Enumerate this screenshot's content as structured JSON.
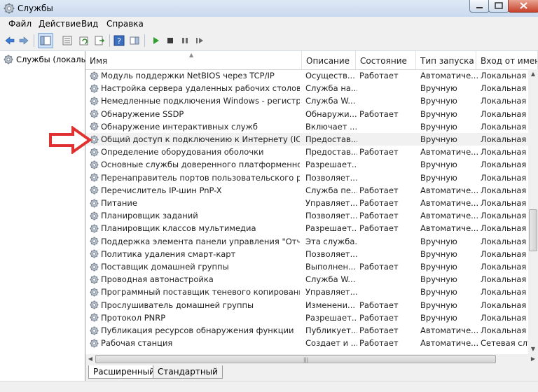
{
  "window": {
    "title": "Службы"
  },
  "menu": {
    "file": "Файл",
    "action": "Действие",
    "view": "Вид",
    "help": "Справка"
  },
  "left_pane": {
    "tree_item": "Службы (локалы"
  },
  "columns": {
    "name": "Имя",
    "description": "Описание",
    "status": "Состояние",
    "startup": "Тип запуска",
    "logon": "Вход от имен"
  },
  "rows": [
    {
      "name": "Модуль поддержки NetBIOS через TCP/IP",
      "desc": "Осуществ...",
      "status": "Работает",
      "startup": "Автоматиче...",
      "logon": "Локальная с"
    },
    {
      "name": "Настройка сервера удаленных рабочих столов",
      "desc": "Служба на...",
      "status": "",
      "startup": "Вручную",
      "logon": "Локальная с"
    },
    {
      "name": "Немедленные подключения Windows - регистратор...",
      "desc": "Служба W...",
      "status": "",
      "startup": "Вручную",
      "logon": "Локальная с"
    },
    {
      "name": "Обнаружение SSDP",
      "desc": "Обнаружи...",
      "status": "Работает",
      "startup": "Вручную",
      "logon": "Локальная с"
    },
    {
      "name": "Обнаружение интерактивных служб",
      "desc": "Включает ...",
      "status": "",
      "startup": "Вручную",
      "logon": "Локальная с"
    },
    {
      "name": "Общий доступ к подключению к Интернету (ICS)",
      "desc": "Предостав...",
      "status": "",
      "startup": "Вручную",
      "logon": "Локальная с"
    },
    {
      "name": "Определение оборудования оболочки",
      "desc": "Предостав...",
      "status": "Работает",
      "startup": "Автоматиче...",
      "logon": "Локальная с"
    },
    {
      "name": "Основные службы доверенного платформенного м...",
      "desc": "Разрешает...",
      "status": "",
      "startup": "Вручную",
      "logon": "Локальная с"
    },
    {
      "name": "Перенаправитель портов пользовательского режи...",
      "desc": "Позволяет...",
      "status": "",
      "startup": "Вручную",
      "logon": "Локальная с"
    },
    {
      "name": "Перечислитель IP-шин PnP-X",
      "desc": "Служба пе...",
      "status": "Работает",
      "startup": "Автоматиче...",
      "logon": "Локальная с"
    },
    {
      "name": "Питание",
      "desc": "Управляет...",
      "status": "Работает",
      "startup": "Автоматиче...",
      "logon": "Локальная с"
    },
    {
      "name": "Планировщик заданий",
      "desc": "Позволяет...",
      "status": "Работает",
      "startup": "Автоматиче...",
      "logon": "Локальная с"
    },
    {
      "name": "Планировщик классов мультимедиа",
      "desc": "Разрешает...",
      "status": "Работает",
      "startup": "Автоматиче...",
      "logon": "Локальная с"
    },
    {
      "name": "Поддержка элемента панели управления \"Отчеты о...",
      "desc": "Эта служба...",
      "status": "",
      "startup": "Вручную",
      "logon": "Локальная с"
    },
    {
      "name": "Политика удаления смарт-карт",
      "desc": "Позволяет...",
      "status": "",
      "startup": "Вручную",
      "logon": "Локальная с"
    },
    {
      "name": "Поставщик домашней группы",
      "desc": "Выполнен...",
      "status": "Работает",
      "startup": "Вручную",
      "logon": "Локальная с"
    },
    {
      "name": "Проводная автонастройка",
      "desc": "Служба W...",
      "status": "",
      "startup": "Вручную",
      "logon": "Локальная с"
    },
    {
      "name": "Программный поставщик теневого копирования (...",
      "desc": "Управляет...",
      "status": "",
      "startup": "Вручную",
      "logon": "Локальная с"
    },
    {
      "name": "Прослушиватель домашней группы",
      "desc": "Изменени...",
      "status": "Работает",
      "startup": "Вручную",
      "logon": "Локальная с"
    },
    {
      "name": "Протокол PNRP",
      "desc": "Разрешает...",
      "status": "Работает",
      "startup": "Вручную",
      "logon": "Локальная с"
    },
    {
      "name": "Публикация ресурсов обнаружения функции",
      "desc": "Публикует...",
      "status": "Работает",
      "startup": "Автоматиче...",
      "logon": "Локальная с"
    },
    {
      "name": "Рабочая станция",
      "desc": "Создает и ...",
      "status": "Работает",
      "startup": "Автоматиче...",
      "logon": "Сетевая слу"
    }
  ],
  "tabs": {
    "extended": "Расширенный",
    "standard": "Стандартный"
  },
  "colors": {
    "arrow": "#e03131",
    "titlebar": "#c9d9ee",
    "selected_row": "#f1f1f1"
  }
}
